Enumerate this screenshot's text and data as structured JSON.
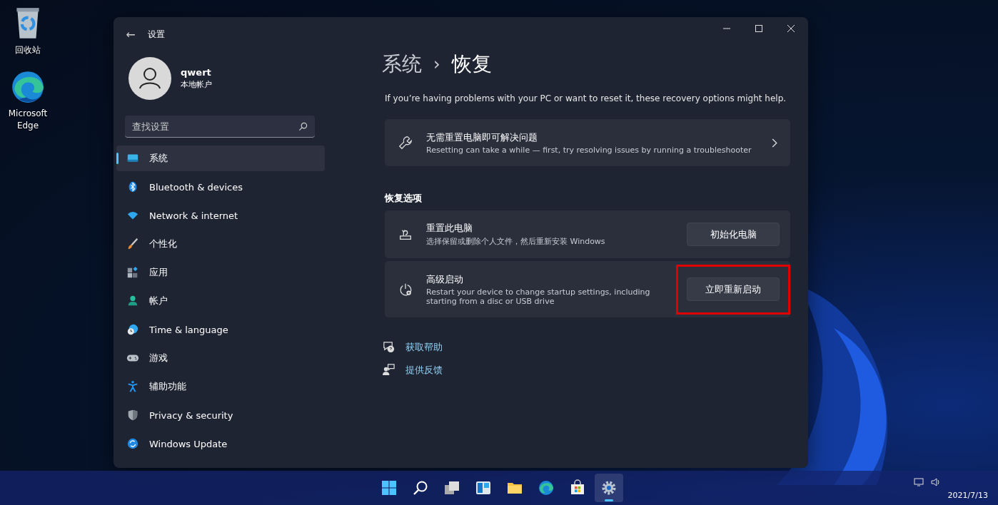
{
  "desktop_icons": [
    {
      "kind": "recycle",
      "label": "回收站"
    },
    {
      "kind": "edge",
      "label": "Microsoft Edge"
    }
  ],
  "window": {
    "title": "设置",
    "back": "←"
  },
  "user": {
    "name": "qwert",
    "account_type": "本地帐户"
  },
  "search": {
    "placeholder": "查找设置"
  },
  "sidebar": {
    "items": [
      {
        "kind": "system",
        "label": "系统",
        "selected": true
      },
      {
        "kind": "bluetooth",
        "label": "Bluetooth & devices",
        "selected": false
      },
      {
        "kind": "network",
        "label": "Network & internet",
        "selected": false
      },
      {
        "kind": "brush",
        "label": "个性化",
        "selected": false
      },
      {
        "kind": "apps",
        "label": "应用",
        "selected": false
      },
      {
        "kind": "person",
        "label": "帐户",
        "selected": false
      },
      {
        "kind": "clock",
        "label": "Time & language",
        "selected": false
      },
      {
        "kind": "gamepad",
        "label": "游戏",
        "selected": false
      },
      {
        "kind": "accessibility",
        "label": "辅助功能",
        "selected": false
      },
      {
        "kind": "shield",
        "label": "Privacy & security",
        "selected": false
      },
      {
        "kind": "update",
        "label": "Windows Update",
        "selected": false
      }
    ]
  },
  "breadcrumb": {
    "parent": "系统",
    "separator": "›",
    "current": "恢复"
  },
  "description": "If you’re having problems with your PC or want to reset it, these recovery options might help.",
  "troubleshoot_card": {
    "title": "无需重置电脑即可解决问题",
    "subtitle": "Resetting can take a while — first, try resolving issues by running a troubleshooter"
  },
  "section_title": "恢复选项",
  "options": [
    {
      "kind": "reset",
      "title": "重置此电脑",
      "subtitle": "选择保留或删除个人文件，然后重新安装 Windows",
      "button": "初始化电脑",
      "highlighted": false
    },
    {
      "kind": "startup",
      "title": "高级启动",
      "subtitle": "Restart your device to change startup settings, including starting from a disc or USB drive",
      "button": "立即重新启动",
      "highlighted": true
    }
  ],
  "links": [
    {
      "kind": "help",
      "label": "获取帮助"
    },
    {
      "kind": "feedback",
      "label": "提供反馈"
    }
  ],
  "taskbar": {
    "apps": [
      {
        "kind": "start",
        "selected": false
      },
      {
        "kind": "search",
        "selected": false
      },
      {
        "kind": "taskview",
        "selected": false
      },
      {
        "kind": "widgets",
        "selected": false
      },
      {
        "kind": "explorer",
        "selected": false
      },
      {
        "kind": "edge",
        "selected": false
      },
      {
        "kind": "store",
        "selected": false
      },
      {
        "kind": "settings",
        "selected": true
      }
    ],
    "date": "2021/7/13"
  }
}
